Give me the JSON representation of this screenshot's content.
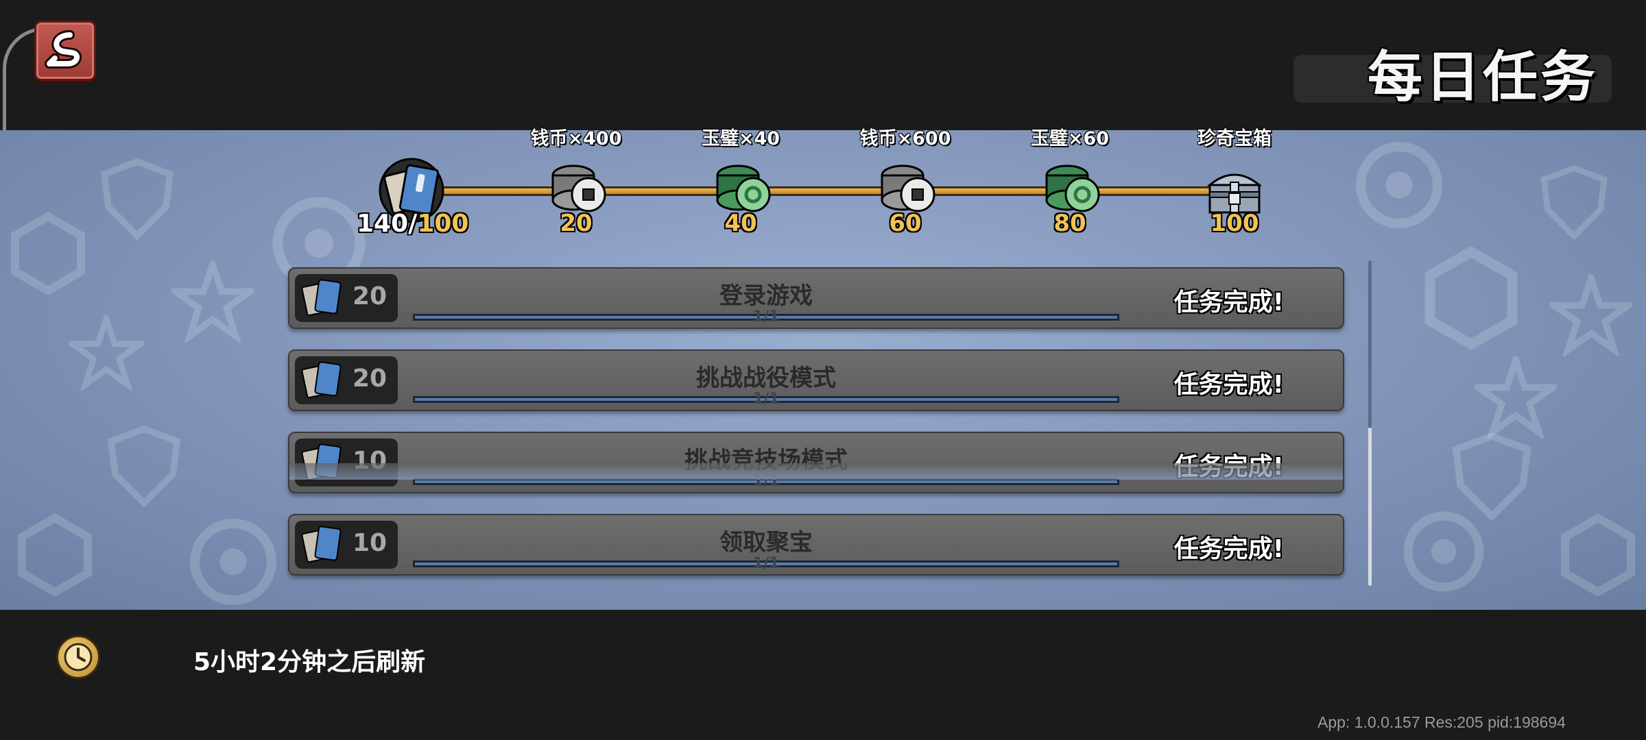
{
  "header": {
    "title": "每日任务"
  },
  "progress": {
    "current": "140",
    "max": "100",
    "milestones": [
      {
        "label": "钱币×400",
        "value": "20",
        "icon": "silver-coin-stack-icon"
      },
      {
        "label": "玉璧×40",
        "value": "40",
        "icon": "jade-coin-stack-icon"
      },
      {
        "label": "钱币×600",
        "value": "60",
        "icon": "silver-coin-stack-icon"
      },
      {
        "label": "玉璧×60",
        "value": "80",
        "icon": "jade-coin-stack-icon"
      },
      {
        "label": "珍奇宝箱",
        "value": "100",
        "icon": "treasure-chest-icon"
      }
    ]
  },
  "tasks": [
    {
      "reward": "20",
      "name": "登录游戏",
      "count": "1/1",
      "progress": 1,
      "status": "任务完成!"
    },
    {
      "reward": "20",
      "name": "挑战战役模式",
      "count": "1/1",
      "progress": 1,
      "status": "任务完成!"
    },
    {
      "reward": "10",
      "name": "挑战竞技场模式",
      "count": "1/1",
      "progress": 1,
      "status": "任务完成!"
    },
    {
      "reward": "10",
      "name": "领取聚宝",
      "count": "1/1",
      "progress": 1,
      "status": "任务完成!"
    }
  ],
  "footer": {
    "refresh_text": "5小时2分钟之后刷新",
    "app_info": "App: 1.0.0.157 Res:205 pid:198694"
  },
  "colors": {
    "accent_gold": "#f1c255",
    "track_orange": "#e0a040",
    "panel_blue": "#8598bc",
    "row_gray": "#666666"
  }
}
